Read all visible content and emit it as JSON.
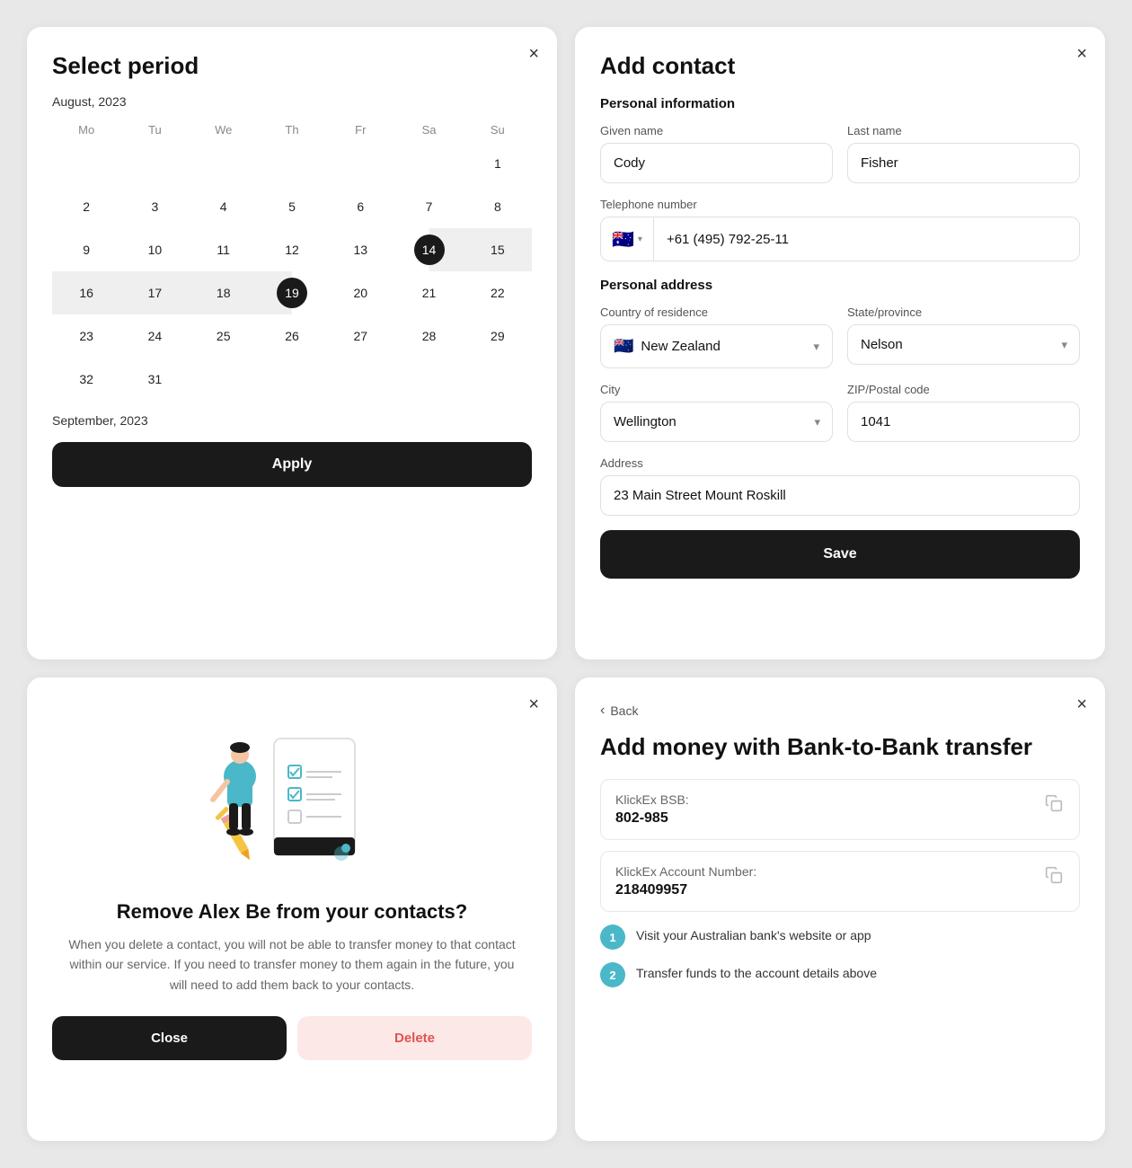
{
  "calendar": {
    "title": "Select period",
    "month1": "August, 2023",
    "month2": "September, 2023",
    "days_header": [
      "Mo",
      "Tu",
      "We",
      "Th",
      "Fr",
      "Sa",
      "Su"
    ],
    "apply_label": "Apply",
    "close_label": "×",
    "weeks": [
      [
        "",
        "",
        "",
        "",
        "",
        "",
        "1"
      ],
      [
        "2",
        "3",
        "4",
        "5",
        "6",
        "7",
        "8"
      ],
      [
        "9",
        "10",
        "11",
        "12",
        "13",
        "14",
        "15"
      ],
      [
        "16",
        "17",
        "18",
        "19",
        "20",
        "21",
        "22"
      ],
      [
        "23",
        "24",
        "25",
        "26",
        "27",
        "28",
        "29"
      ],
      [
        "32",
        "31",
        "",
        "",
        "",
        "",
        ""
      ]
    ],
    "selected_start": "14",
    "selected_end": "19",
    "range": [
      "15",
      "16",
      "17",
      "18"
    ]
  },
  "remove_contact": {
    "title": "Remove Alex Be from your contacts?",
    "description": "When you delete a contact, you will not be able to transfer money to that contact within our service. If you need to transfer money to them again in the future, you will need to add them back to your contacts.",
    "close_label": "Close",
    "delete_label": "Delete",
    "close_icon": "×"
  },
  "add_contact": {
    "title": "Add contact",
    "close_icon": "×",
    "personal_info_label": "Personal information",
    "given_name_label": "Given name",
    "given_name_value": "Cody",
    "last_name_label": "Last name",
    "last_name_value": "Fisher",
    "telephone_label": "Telephone number",
    "country_code": "+61",
    "phone_number": "(495) 792-25-11",
    "flag_emoji": "🇦🇺",
    "personal_address_label": "Personal address",
    "country_label": "Country of residence",
    "country_value": "New Zealand",
    "country_flag": "🇳🇿",
    "state_label": "State/province",
    "state_value": "Nelson",
    "city_label": "City",
    "city_value": "Wellington",
    "zip_label": "ZIP/Postal code",
    "zip_value": "1041",
    "address_label": "Address",
    "address_value": "23 Main Street Mount Roskill",
    "save_label": "Save"
  },
  "bank_transfer": {
    "title": "Add money with Bank-to-Bank transfer",
    "close_icon": "×",
    "back_label": "Back",
    "bsb_label": "KlickEx BSB:",
    "bsb_value": "802-985",
    "account_label": "KlickEx Account Number:",
    "account_value": "218409957",
    "step1": "Visit your Australian bank's website or app",
    "step2": "Transfer funds to the account details above"
  }
}
